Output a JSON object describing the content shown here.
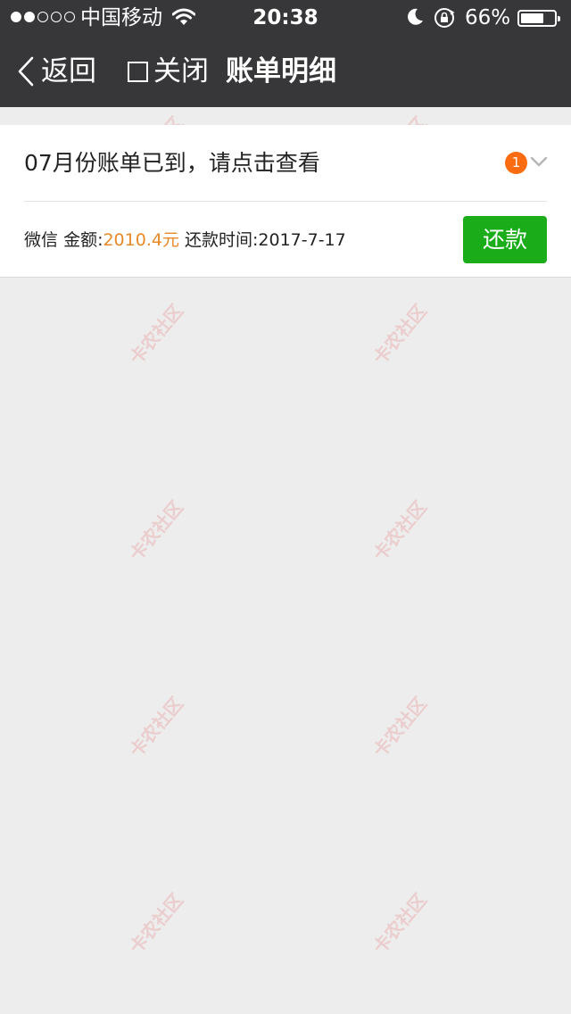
{
  "status_bar": {
    "carrier": "中国移动",
    "time": "20:38",
    "battery_percent": "66%",
    "battery_level": 0.66,
    "signal_bars_filled": 2,
    "signal_bars_total": 5,
    "icons": [
      "wifi-icon",
      "moon-icon",
      "rotation-lock-icon",
      "battery-icon"
    ]
  },
  "nav": {
    "back_label": "返回",
    "close_label": "关闭",
    "title": "账单明细",
    "icons": [
      "chevron-left-icon",
      "checkbox-icon"
    ]
  },
  "bill": {
    "title": "07月份账单已到，请点击查看",
    "badge_count": "1",
    "source_label": "微信",
    "amount_label": "金额:",
    "amount_value": "2010.4元",
    "due_label": "还款时间:",
    "due_date": "2017-7-17",
    "pay_button": "还款",
    "icons": [
      "chevron-down-icon"
    ]
  },
  "watermark": {
    "text": "卡农社区"
  },
  "colors": {
    "nav_background": "#373639",
    "page_background": "#ededed",
    "amount": "#e98a28",
    "badge": "#fb6b0f",
    "pay_button": "#1aad19"
  }
}
